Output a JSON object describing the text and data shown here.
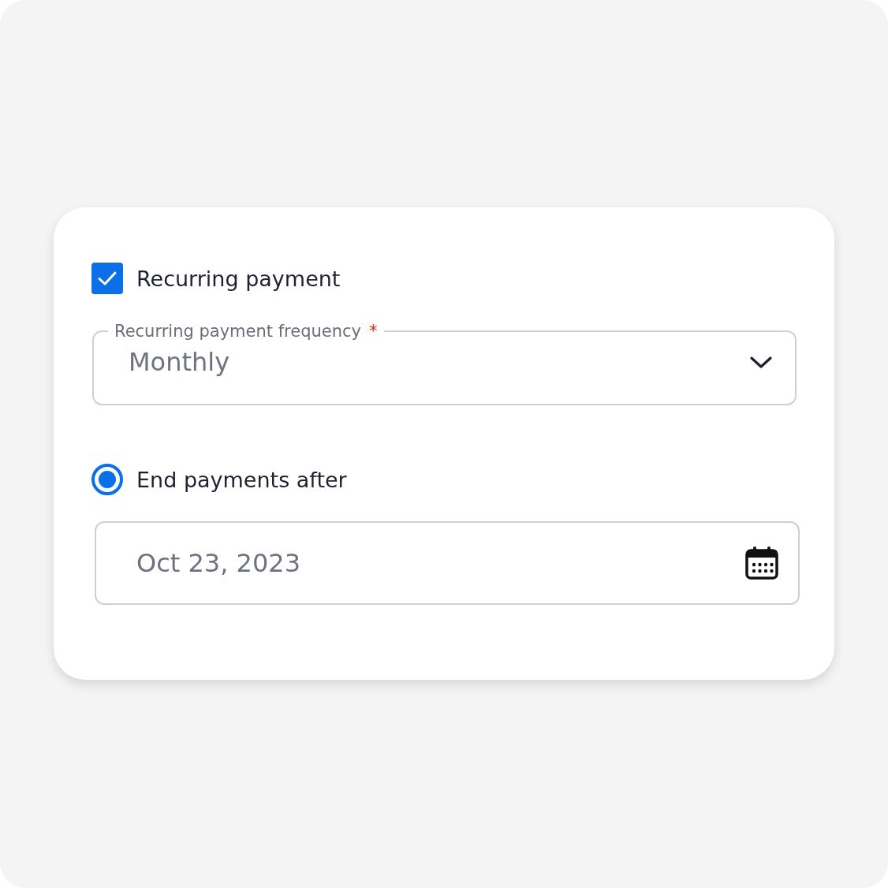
{
  "recurring": {
    "label": "Recurring payment",
    "checked": true
  },
  "frequency": {
    "label": "Recurring payment frequency",
    "required_mark": "*",
    "value": "Monthly"
  },
  "end_option": {
    "label": "End payments after",
    "selected": true
  },
  "end_date": {
    "value": "Oct 23, 2023"
  }
}
